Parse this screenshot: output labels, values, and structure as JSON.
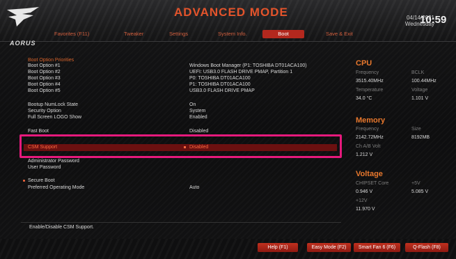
{
  "header": {
    "logo_text": "AORUS",
    "title": "ADVANCED MODE",
    "date": "04/14/2021",
    "weekday": "Wednesday",
    "time": "10:59",
    "tabs": [
      {
        "label": "Favorites (F11)",
        "active": false
      },
      {
        "label": "Tweaker",
        "active": false
      },
      {
        "label": "Settings",
        "active": false
      },
      {
        "label": "System Info.",
        "active": false
      },
      {
        "label": "Boot",
        "active": true
      },
      {
        "label": "Save & Exit",
        "active": false
      }
    ]
  },
  "main": {
    "boot_priorities": {
      "title": "Boot Option Priorities",
      "items": [
        {
          "label": "Boot Option #1",
          "value": "Windows Boot Manager (P1: TOSHIBA DT01ACA100)"
        },
        {
          "label": "Boot Option #2",
          "value": "UEFI: USB3.0 FLASH DRIVE PMAP, Partition 1"
        },
        {
          "label": "Boot Option #3",
          "value": "P0: TOSHIBA DT01ACA100"
        },
        {
          "label": "Boot Option #4",
          "value": "P1: TOSHIBA DT01ACA100"
        },
        {
          "label": "Boot Option #5",
          "value": "USB3.0 FLASH DRIVE PMAP"
        }
      ]
    },
    "options": [
      {
        "label": "Bootup NumLock State",
        "value": "On"
      },
      {
        "label": "Security Option",
        "value": "System"
      },
      {
        "label": "Full Screen LOGO Show",
        "value": "Enabled"
      },
      {
        "label": "Fast Boot",
        "value": "Disabled"
      }
    ],
    "csm": {
      "label": "CSM Support",
      "value": "Disabled"
    },
    "passwords": [
      {
        "label": "Administrator Password"
      },
      {
        "label": "User Password"
      }
    ],
    "secure_boot": {
      "label": "Secure Boot"
    },
    "preferred_mode": {
      "label": "Preferred Operating Mode",
      "value": "Auto"
    },
    "help_text": "Enable/Disable CSM Support."
  },
  "right_panel": {
    "cpu": {
      "title": "CPU",
      "frequency_label": "Frequency",
      "frequency_value": "3515.40MHz",
      "bclk_label": "BCLK",
      "bclk_value": "100.44MHz",
      "temperature_label": "Temperature",
      "temperature_value": "34.0 °C",
      "voltage_label": "Voltage",
      "voltage_value": "1.101 V"
    },
    "memory": {
      "title": "Memory",
      "frequency_label": "Frequency",
      "frequency_value": "2142.72MHz",
      "size_label": "Size",
      "size_value": "8192MB",
      "volt_label": "Ch A/B Volt",
      "volt_value": "1.212 V"
    },
    "voltage": {
      "title": "Voltage",
      "chipset_label": "CHIPSET Core",
      "chipset_value": "0.946 V",
      "plus5_label": "+5V",
      "plus5_value": "5.085 V",
      "plus12_label": "+12V",
      "plus12_value": "11.970 V"
    }
  },
  "footer": {
    "buttons": [
      {
        "label": "Help (F1)"
      },
      {
        "label": "Easy Mode (F2)"
      },
      {
        "label": "Smart Fan 6 (F6)"
      },
      {
        "label": "Q-Flash (F8)"
      }
    ]
  },
  "colors": {
    "accent": "#e4542b",
    "active_tab": "#b3281e",
    "highlight_box": "#e6197c",
    "selected_row": "#6b1010"
  }
}
